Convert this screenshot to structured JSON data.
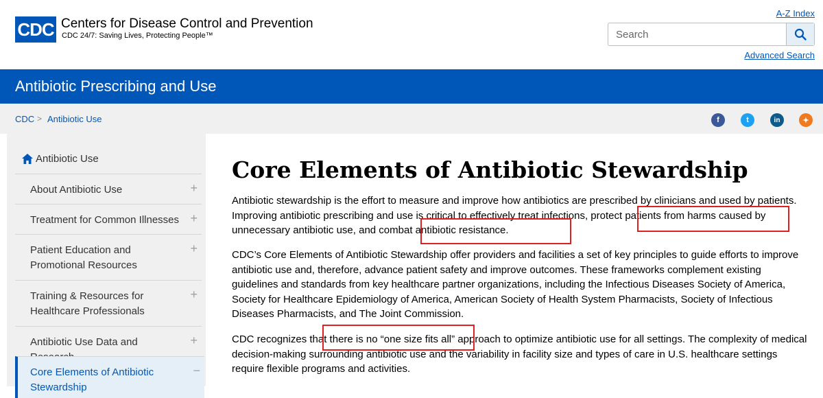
{
  "header": {
    "logo_text": "CDC",
    "org_name": "Centers for Disease Control and Prevention",
    "tagline": "CDC 24/7: Saving Lives, Protecting People™",
    "az_index": "A-Z Index",
    "search_placeholder": "Search",
    "advanced_search": "Advanced Search"
  },
  "site_bar": {
    "title": "Antibiotic Prescribing and Use"
  },
  "breadcrumb": {
    "home": "CDC",
    "separator": ">",
    "current": "Antibiotic Use"
  },
  "social": [
    {
      "name": "facebook",
      "glyph": "f",
      "color": "#3b5998"
    },
    {
      "name": "twitter",
      "glyph": "t",
      "color": "#1da1f2"
    },
    {
      "name": "linkedin",
      "glyph": "in",
      "color": "#0e5a8a"
    },
    {
      "name": "syndicate",
      "glyph": "✦",
      "color": "#f07a1f"
    }
  ],
  "sidebar": {
    "home_label": "Antibiotic Use",
    "items": [
      {
        "label": "About Antibiotic Use",
        "toggle": "+"
      },
      {
        "label": "Treatment for Common Illnesses",
        "toggle": "+"
      },
      {
        "label": "Patient Education and Promotional Resources",
        "toggle": "+"
      },
      {
        "label": "Training & Resources for Healthcare Professionals",
        "toggle": "+"
      },
      {
        "label": "Antibiotic Use Data and Research",
        "toggle": "+"
      },
      {
        "label": "Core Elements of Antibiotic Stewardship",
        "toggle": "−"
      }
    ]
  },
  "main": {
    "title": "Core Elements of Antibiotic Stewardship",
    "p1": "Antibiotic stewardship is the effort to measure and improve how antibiotics are prescribed by clinicians and used by patients. Improving antibiotic prescribing and use is critical to effectively treat infections, protect patients from harms caused by unnecessary antibiotic use, and combat antibiotic resistance.",
    "p2": "CDC’s Core Elements of Antibiotic Stewardship offer providers and facilities a set of key principles to guide efforts to improve antibiotic use and, therefore, advance patient safety and improve outcomes. These frameworks complement existing guidelines and standards from key healthcare partner organizations, including the Infectious Diseases Society of America, Society for Healthcare Epidemiology of America, American Society of Health System Pharmacists, Society of Infectious Diseases Pharmacists, and The Joint Commission.",
    "p3": "CDC recognizes that there is no “one size fits all” approach to optimize antibiotic use for all settings. The complexity of medical decision-making surrounding antibiotic use and the variability in facility size and types of care in U.S. healthcare settings require flexible programs and activities."
  },
  "colors": {
    "brand": "#0057b7",
    "highlight": "#e02020"
  }
}
